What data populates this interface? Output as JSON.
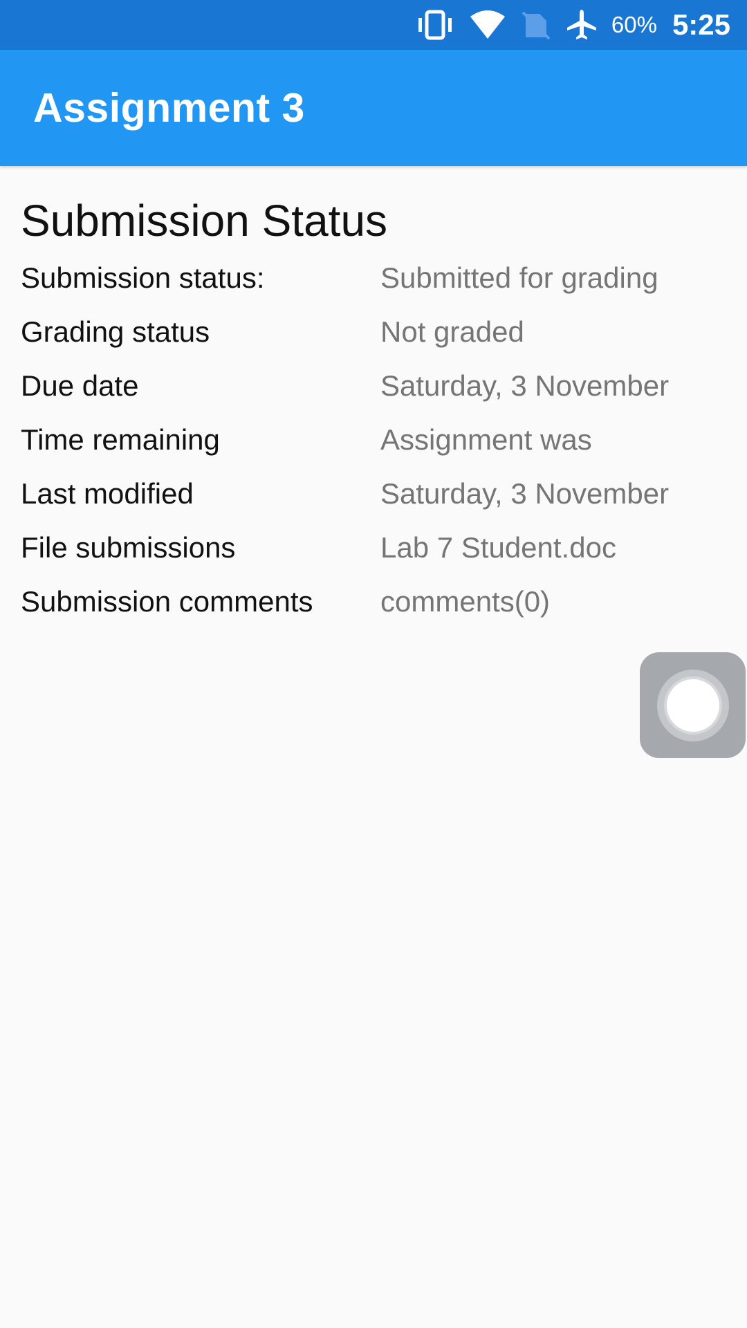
{
  "status_bar": {
    "icons": [
      "vibrate-icon",
      "wifi-icon",
      "no-sim-icon",
      "airplane-mode-icon"
    ],
    "battery": "60%",
    "time": "5:25"
  },
  "app_bar": {
    "title": "Assignment 3"
  },
  "submission": {
    "heading": "Submission Status",
    "rows": [
      {
        "label": "Submission status:",
        "value": "Submitted for grading"
      },
      {
        "label": "Grading status",
        "value": "Not graded"
      },
      {
        "label": "Due date",
        "value": "Saturday, 3 November"
      },
      {
        "label": "Time remaining",
        "value": "Assignment was"
      },
      {
        "label": "Last modified",
        "value": "Saturday, 3 November"
      },
      {
        "label": "File submissions",
        "value": "Lab 7 Student.doc"
      },
      {
        "label": "Submission comments",
        "value": "comments(0)"
      }
    ]
  },
  "colors": {
    "status_bar": "#1976d2",
    "app_bar": "#2196f3",
    "label_text": "#111111",
    "value_text": "#757575"
  },
  "floating_button": {
    "icon": "assistive-touch-icon"
  }
}
